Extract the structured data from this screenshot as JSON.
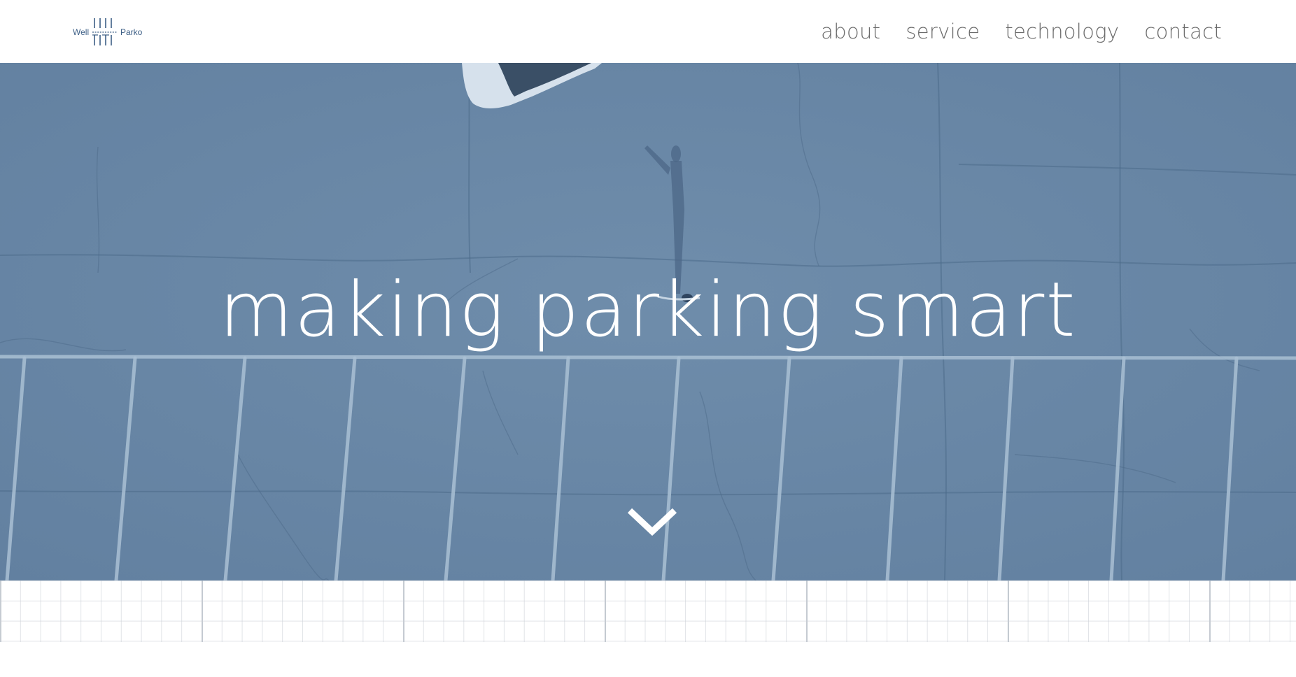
{
  "brand": {
    "left_word": "Well",
    "right_word": "Parko",
    "color": "#3d5f86"
  },
  "nav": {
    "items": [
      {
        "label": "about"
      },
      {
        "label": "service"
      },
      {
        "label": "technology"
      },
      {
        "label": "contact"
      }
    ]
  },
  "hero": {
    "headline": "making parking smart",
    "overlay_color": "#6886a4",
    "scroll_icon": "chevron-down-icon"
  },
  "colors": {
    "nav_text": "#6b6b6b",
    "hero_text": "#ffffff",
    "grid_line": "#c8cdd4"
  }
}
